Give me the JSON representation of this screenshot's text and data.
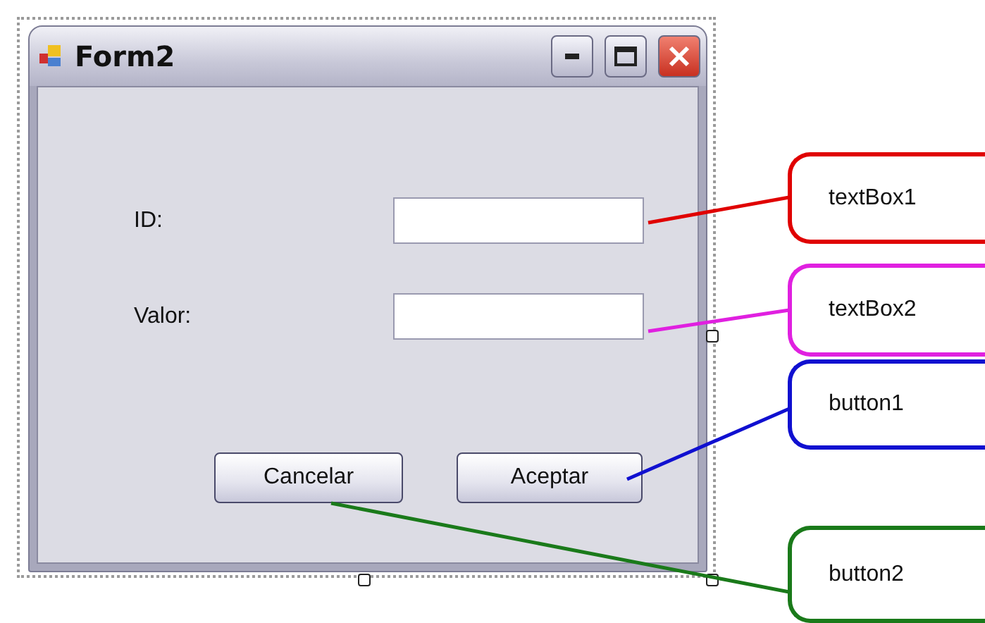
{
  "window": {
    "title": "Form2"
  },
  "fields": [
    {
      "label": "ID:"
    },
    {
      "label": "Valor:"
    }
  ],
  "buttons": [
    "Cancelar",
    "Aceptar"
  ],
  "annotations": [
    {
      "label": "textBox1",
      "color": "#e00000"
    },
    {
      "label": "textBox2",
      "color": "#e020e0"
    },
    {
      "label": "button1",
      "color": "#1010d0"
    },
    {
      "label": "button2",
      "color": "#1a7a1a"
    }
  ]
}
